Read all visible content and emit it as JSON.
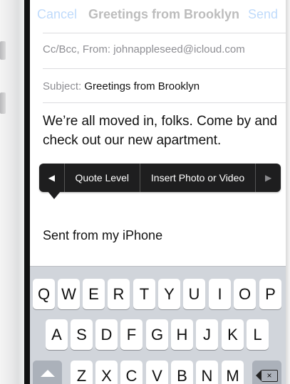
{
  "nav": {
    "cancel_label": "Cancel",
    "title": "Greetings from Brooklyn",
    "send_label": "Send"
  },
  "compose": {
    "cc_bcc_from_label": "Cc/Bcc, From:",
    "from_value": "johnappleseed@icloud.com",
    "subject_label": "Subject:",
    "subject_value": "Greetings from Brooklyn",
    "body": "We’re all moved in, folks. Come by and check out our new apartment.",
    "signature": "Sent from my iPhone"
  },
  "edit_menu": {
    "prev_arrow": "◀",
    "items": [
      "Quote Level",
      "Insert Photo or Video"
    ],
    "next_arrow": "▶"
  },
  "keyboard": {
    "row1": [
      "Q",
      "W",
      "E",
      "R",
      "T",
      "Y",
      "U",
      "I",
      "O",
      "P"
    ],
    "row2": [
      "A",
      "S",
      "D",
      "F",
      "G",
      "H",
      "J",
      "K",
      "L"
    ],
    "row3": [
      "Z",
      "X",
      "C",
      "V",
      "B",
      "N",
      "M"
    ],
    "delete_glyph": "×"
  },
  "colors": {
    "accent": "#1a7cf2",
    "menu_bg": "#1e1e1f",
    "keyboard_bg": "#d1d5db"
  }
}
